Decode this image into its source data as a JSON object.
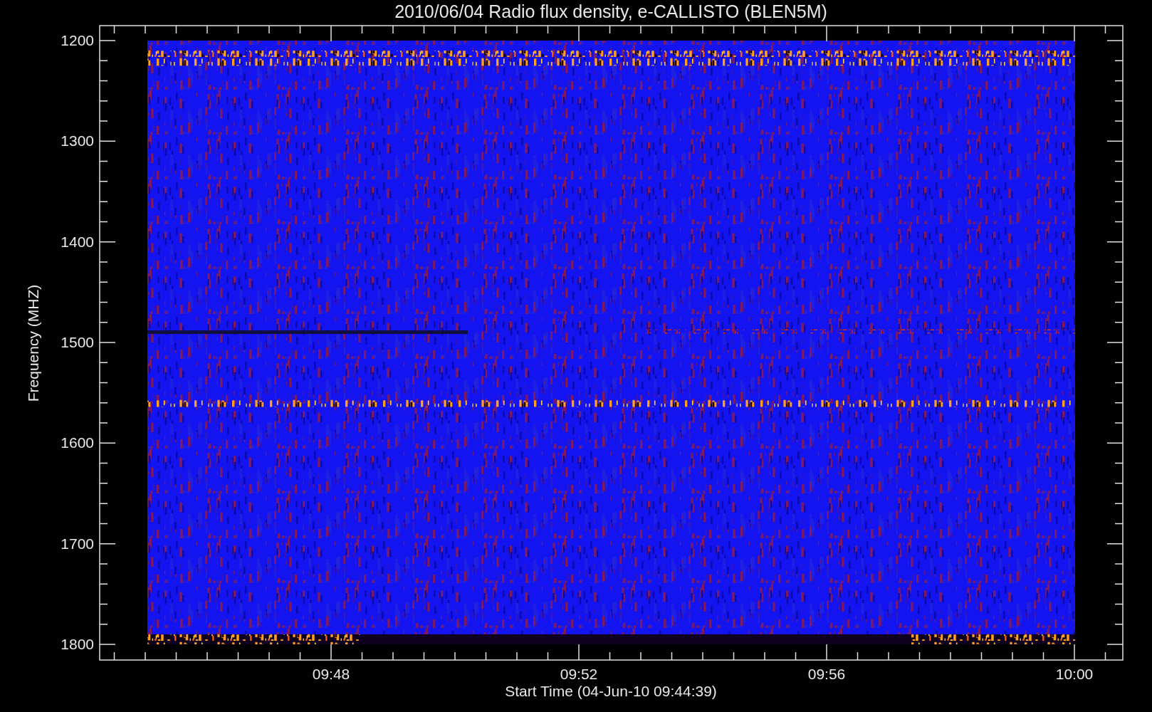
{
  "title": "2010/06/04  Radio flux density, e-CALLISTO (BLEN5M)",
  "y_axis": {
    "label": "Frequency (MHZ)",
    "ticks": [
      "1200",
      "1300",
      "1400",
      "1500",
      "1600",
      "1700",
      "1800"
    ]
  },
  "x_axis": {
    "label": "Start Time (04-Jun-10 09:44:39)",
    "ticks": [
      "09:48",
      "09:52",
      "09:56",
      "10:00"
    ]
  }
}
